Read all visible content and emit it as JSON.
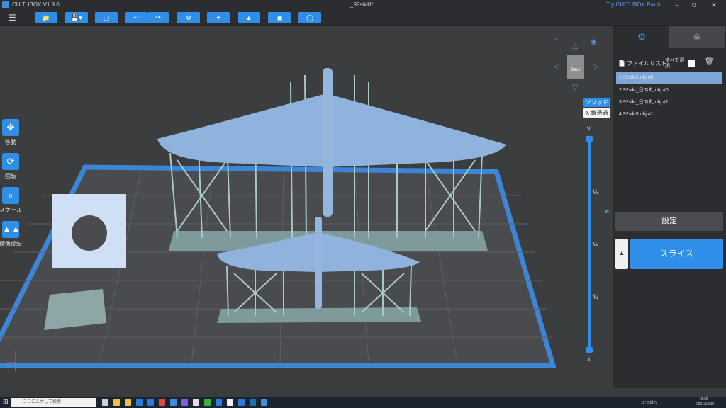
{
  "window": {
    "app_name": "CHITUBOX V1.9.0",
    "doc_title": "_92siki8*",
    "promo": "Try CHITUBOX Pro"
  },
  "left_tools": [
    {
      "label": "移動"
    },
    {
      "label": "回転"
    },
    {
      "label": "スケール"
    },
    {
      "label": "鏡像反転"
    }
  ],
  "view": {
    "cube_face": "Back",
    "solid_label": "ソリッド",
    "xray_label": "X 線透過"
  },
  "slider": {
    "ticks": [
      "¼",
      "½",
      "¾"
    ]
  },
  "panel": {
    "file_list_label": "ファイルリスト:",
    "select_all_label": "すべて選択",
    "files": [
      {
        "name": "1.92siki5.obj #0",
        "selected": true
      },
      {
        "name": "2.92siki_日の丸.obj #0",
        "selected": false
      },
      {
        "name": "3.92siki_日の丸.obj #1",
        "selected": false
      },
      {
        "name": "4.92siki5.obj #1",
        "selected": false
      }
    ],
    "settings_label": "設定",
    "slice_label": "スライス"
  },
  "taskbar": {
    "search_placeholder": "ここに入力して検索",
    "weather": "12°C 晴れ",
    "time": "16:26",
    "date": "2021/12/09"
  },
  "colors": {
    "accent": "#2f8fe8",
    "model": "#8fb3dc",
    "supports": "#a9c9c9",
    "build_plate_border": "#3b86d6"
  }
}
